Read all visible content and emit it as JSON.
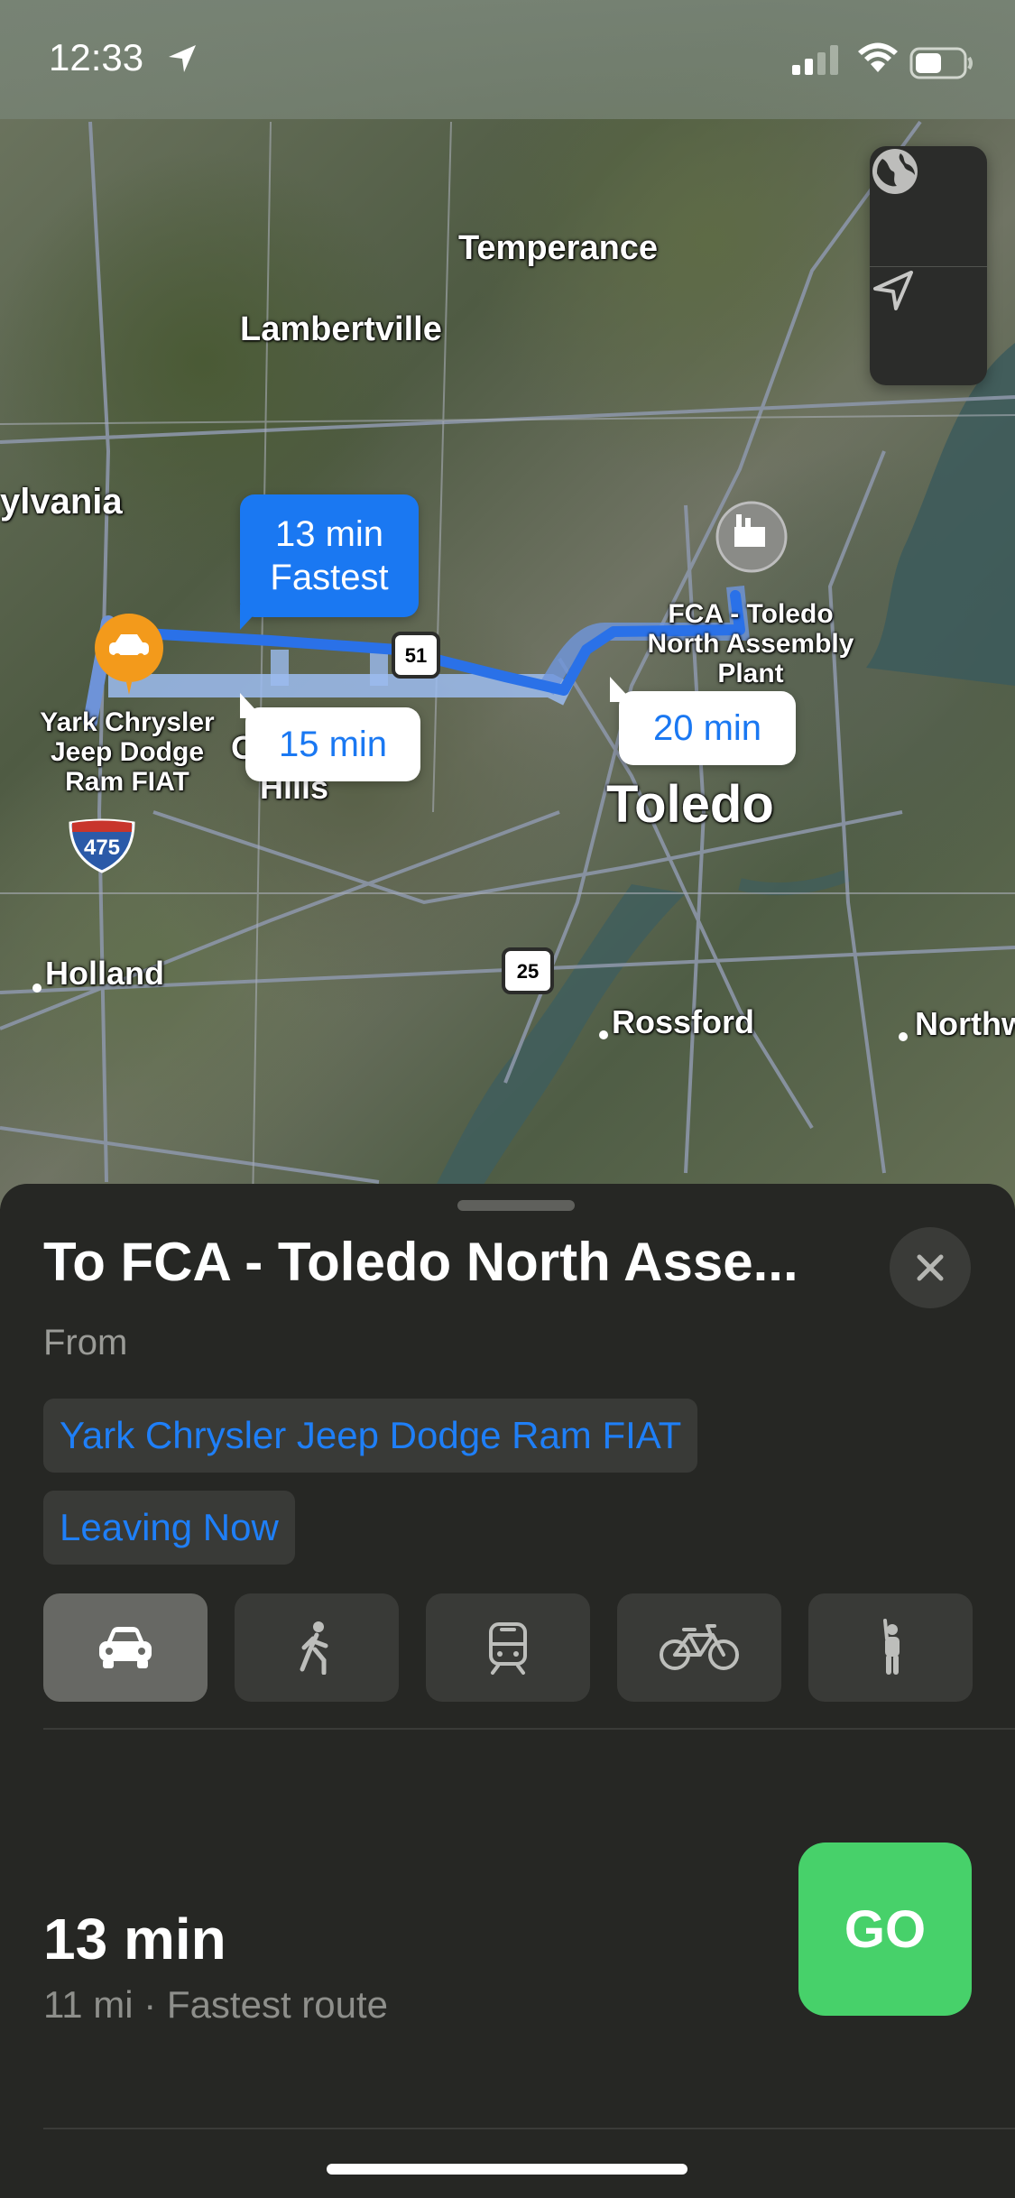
{
  "status_bar": {
    "time": "12:33",
    "icons": [
      "location-arrow-icon",
      "signal-icon",
      "wifi-icon",
      "battery-icon"
    ]
  },
  "map": {
    "controls": [
      "globe-icon",
      "location-icon"
    ],
    "places": {
      "temperance": "Temperance",
      "lambertville": "Lambertville",
      "sylvania": "ylvania",
      "toledo": "Toledo",
      "holland": "Holland",
      "rossford": "Rossford",
      "northwood": "Northw",
      "hills": "Hills",
      "o_letter": "O"
    },
    "origin": {
      "line1": "Yark Chrysler",
      "line2": "Jeep Dodge",
      "line3": "Ram FIAT"
    },
    "destination": {
      "line1": "FCA - Toledo",
      "line2": "North Assembly",
      "line3": "Plant"
    },
    "highway_shields": {
      "i475": "475",
      "us51": "51",
      "us25": "25"
    },
    "route_bubbles": {
      "fastest_time": "13 min",
      "fastest_label": "Fastest",
      "alt1_time": "15 min",
      "alt2_time": "20 min"
    },
    "colors": {
      "route_primary": "#1a78f2",
      "route_alt": "#8fb5ee",
      "origin_pin": "#f39a1b"
    }
  },
  "sheet": {
    "title": "To FCA - Toledo North Asse...",
    "from_label": "From",
    "from_value": "Yark Chrysler Jeep Dodge Ram FIAT",
    "leaving": "Leaving Now",
    "modes": [
      {
        "name": "drive",
        "icon": "car-icon",
        "active": true
      },
      {
        "name": "walk",
        "icon": "walk-icon",
        "active": false
      },
      {
        "name": "transit",
        "icon": "transit-icon",
        "active": false
      },
      {
        "name": "cycle",
        "icon": "bicycle-icon",
        "active": false
      },
      {
        "name": "ride",
        "icon": "rideshare-icon",
        "active": false
      }
    ],
    "eta": "13 min",
    "route_info": "11 mi · Fastest route",
    "go_label": "GO",
    "colors": {
      "go": "#47d16a",
      "link": "#1f7ff7"
    }
  }
}
